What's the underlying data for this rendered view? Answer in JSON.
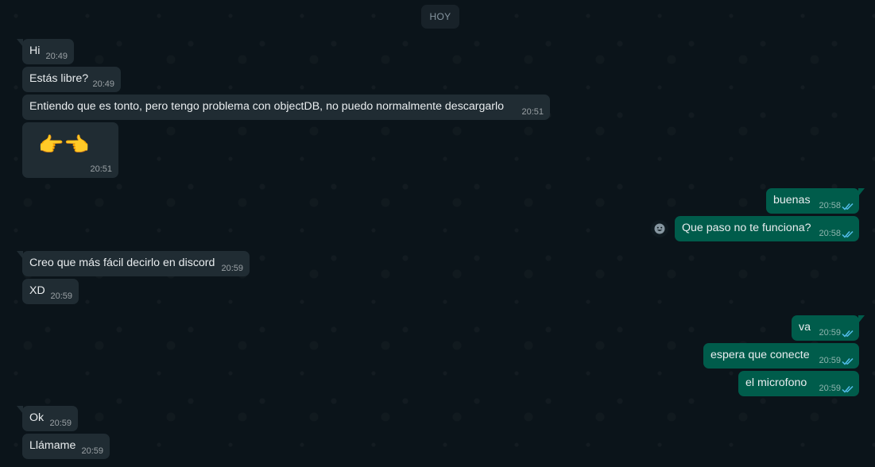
{
  "date_chip": "HOY",
  "messages": [
    {
      "text": "Hi",
      "time": "20:49"
    },
    {
      "text": "Estás libre?",
      "time": "20:49"
    },
    {
      "text": "Entiendo que es tonto, pero tengo problema con objectDB, no puedo normalmente descargarlo",
      "time": "20:51"
    },
    {
      "text": "👉👈",
      "time": "20:51"
    },
    {
      "text": "buenas",
      "time": "20:58"
    },
    {
      "text": "Que paso no te funciona?",
      "time": "20:58"
    },
    {
      "text": "Creo que más fácil decirlo en discord",
      "time": "20:59"
    },
    {
      "text": "XD",
      "time": "20:59"
    },
    {
      "text": "va",
      "time": "20:59"
    },
    {
      "text": "espera que conecte",
      "time": "20:59"
    },
    {
      "text": "el microfono",
      "time": "20:59"
    },
    {
      "text": "Ok",
      "time": "20:59"
    },
    {
      "text": "Llámame",
      "time": "20:59"
    }
  ],
  "colors": {
    "background": "#0b141a",
    "incoming_bubble": "#202c33",
    "outgoing_bubble": "#005c4b",
    "read_ticks": "#53bdeb"
  },
  "icons": {
    "read_receipt": "double-check-icon",
    "reaction": "smiley-icon"
  }
}
